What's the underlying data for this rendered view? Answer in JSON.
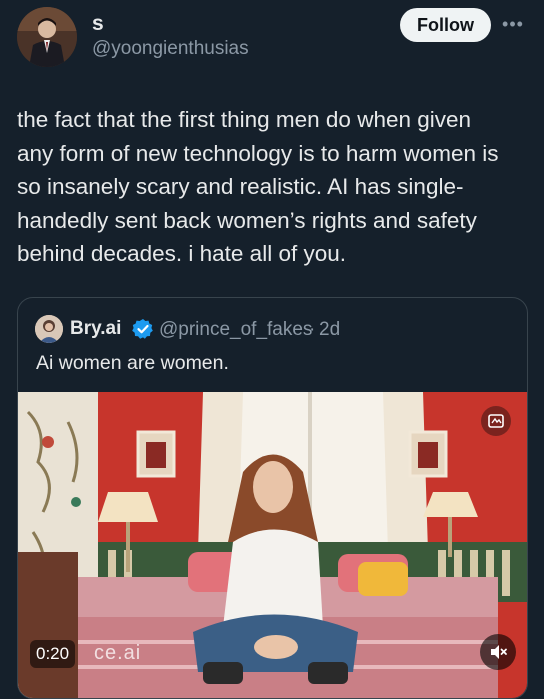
{
  "tweet": {
    "author": {
      "display_name": "s",
      "handle": "@yoongienthusias",
      "avatar_icon": "avatar-man-in-suit"
    },
    "follow_label": "Follow",
    "more_icon": "ellipsis-icon",
    "text": "the fact that the first thing men do when given\nany form of new technology is to harm women is\nso insanely scary and realistic. AI has single-\nhandedly sent back women’s rights and safety\nbehind decades. i hate all of you."
  },
  "quote": {
    "display_name": "Bry.ai",
    "verified_icon": "verified-badge-icon",
    "handle": "@prince_of_fakes",
    "separator": "·",
    "time": "2d",
    "text": "Ai women are women.",
    "media": {
      "duration": "0:20",
      "watermark": "ce.ai",
      "gif_icon": "gif-badge-icon",
      "mute_icon": "mute-icon"
    }
  },
  "colors": {
    "background": "#15202b",
    "text": "#e7e9ea",
    "muted": "#8b98a5",
    "verified": "#1d9bf0",
    "follow_bg": "#eff3f4"
  }
}
